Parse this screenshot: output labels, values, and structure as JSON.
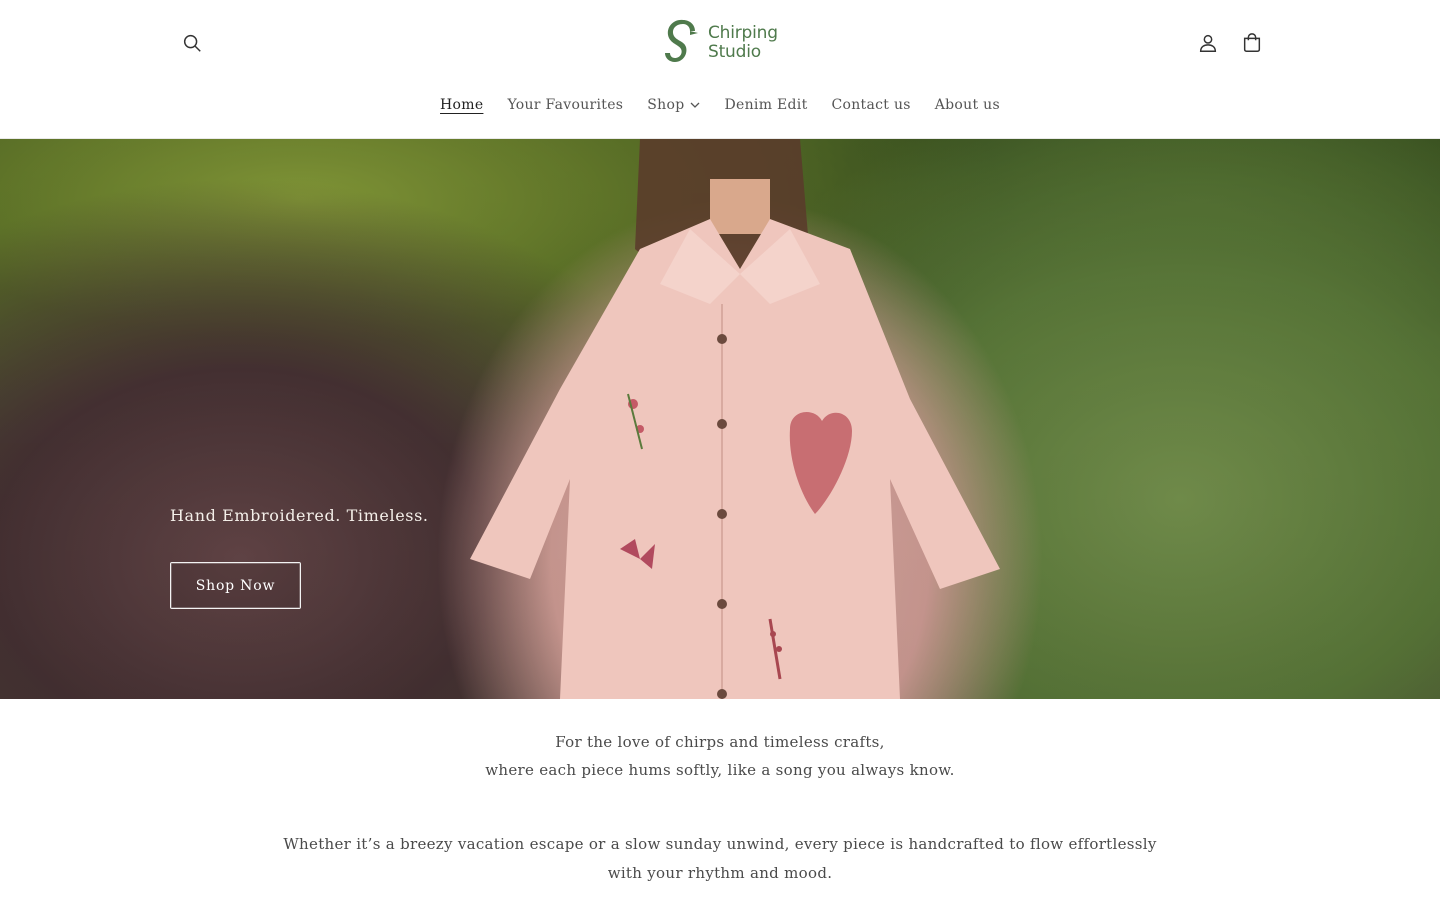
{
  "brand": {
    "name_line1": "Chirping",
    "name_line2": "Studio",
    "color": "#4f7a4c"
  },
  "header": {
    "icons": {
      "search": "search-icon",
      "account": "account-icon",
      "cart": "cart-icon"
    }
  },
  "nav": {
    "items": [
      {
        "label": "Home",
        "active": true
      },
      {
        "label": "Your Favourites"
      },
      {
        "label": "Shop",
        "has_dropdown": true
      },
      {
        "label": "Denim Edit"
      },
      {
        "label": "Contact us"
      },
      {
        "label": "About us"
      }
    ]
  },
  "hero": {
    "tagline": "Hand Embroidered. Timeless.",
    "cta_label": "Shop Now"
  },
  "intro": {
    "line1": "For the love of chirps and timeless crafts,",
    "line2": "where each piece hums softly, like a song you always know.",
    "para2_line1": "Whether it’s a breezy vacation escape or a slow sunday unwind, every piece is handcrafted to flow effortlessly",
    "para2_line2": "with your rhythm and mood."
  }
}
